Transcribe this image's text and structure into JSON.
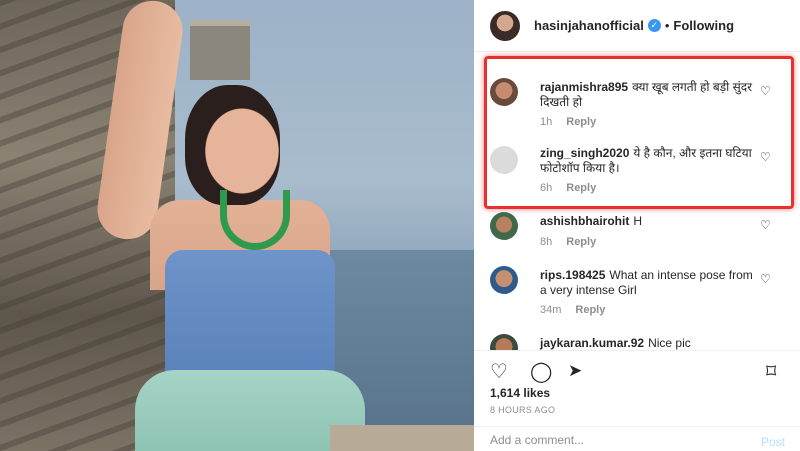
{
  "header": {
    "username": "hasinjahanofficial",
    "verified_mark": "✓",
    "separator": "•",
    "follow_status": "Following"
  },
  "comments": [
    {
      "username": "rajanmishra895",
      "text": "क्या खूब लगती हो बड़ी सुंदर दिखती हो",
      "age": "1h",
      "reply_label": "Reply",
      "highlighted": true
    },
    {
      "username": "zing_singh2020",
      "text": "ये है कौन, और इतना घटिया फोटोशॉप किया है।",
      "age": "6h",
      "reply_label": "Reply",
      "highlighted": true
    },
    {
      "username": "ashishbhairohit",
      "text": "H",
      "age": "8h",
      "reply_label": "Reply",
      "highlighted": false
    },
    {
      "username": "rips.198425",
      "text": "What an intense pose from a very intense Girl",
      "age": "34m",
      "reply_label": "Reply",
      "highlighted": false
    },
    {
      "username": "jaykaran.kumar.92",
      "text": "Nice pic",
      "age": "",
      "reply_label": "",
      "highlighted": false
    }
  ],
  "post": {
    "likes": "1,614 likes",
    "timestamp": "8 HOURS AGO"
  },
  "composer": {
    "placeholder": "Add a comment...",
    "post_label": "Post"
  },
  "icons": {
    "heart": "♡",
    "comment": "◯",
    "share": "➤",
    "save": "⌑"
  },
  "colors": {
    "highlight_border": "#e8302e",
    "verified": "#3897f0",
    "muted_text": "#8e8e8e",
    "post_button_disabled": "#b2dffc"
  }
}
